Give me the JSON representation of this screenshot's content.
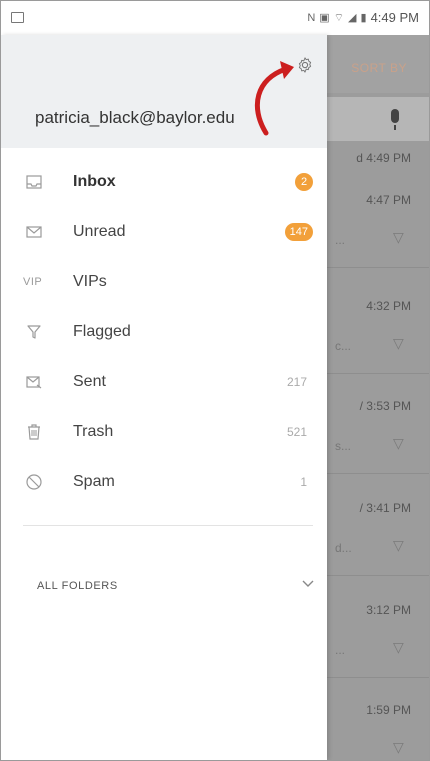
{
  "status_bar": {
    "time": "4:49 PM",
    "icons": [
      "nfc-icon",
      "vibrate-icon",
      "wifi-icon",
      "signal-icon",
      "battery-icon"
    ]
  },
  "background_list": {
    "sort_label": "SORT BY",
    "items": [
      {
        "time": "d 4:49 PM",
        "snippet": ""
      },
      {
        "time": "4:47 PM",
        "snippet": "..."
      },
      {
        "time": "4:32 PM",
        "snippet": "c..."
      },
      {
        "time": "/ 3:53 PM",
        "snippet": "s..."
      },
      {
        "time": "/ 3:41 PM",
        "snippet": "d..."
      },
      {
        "time": "3:12 PM",
        "snippet": "..."
      },
      {
        "time": "1:59 PM",
        "snippet": ""
      }
    ]
  },
  "drawer": {
    "account_email": "patricia_black@baylor.edu",
    "folders": [
      {
        "label": "Inbox",
        "count": "2",
        "badge": true,
        "bold": true,
        "icon": "inbox-icon"
      },
      {
        "label": "Unread",
        "count": "147",
        "badge": true,
        "bold": false,
        "icon": "envelope-icon"
      },
      {
        "label": "VIPs",
        "count": "",
        "badge": false,
        "bold": false,
        "icon": "vip-icon",
        "icon_text": "VIP"
      },
      {
        "label": "Flagged",
        "count": "",
        "badge": false,
        "bold": false,
        "icon": "flag-icon"
      },
      {
        "label": "Sent",
        "count": "217",
        "badge": false,
        "bold": false,
        "icon": "sent-icon"
      },
      {
        "label": "Trash",
        "count": "521",
        "badge": false,
        "bold": false,
        "icon": "trash-icon"
      },
      {
        "label": "Spam",
        "count": "1",
        "badge": false,
        "bold": false,
        "icon": "spam-icon"
      }
    ],
    "all_folders_label": "ALL FOLDERS"
  },
  "colors": {
    "badge": "#f2a03a",
    "annotation_arrow": "#cc1f1f",
    "drawer_header_bg": "#eef0f2"
  }
}
